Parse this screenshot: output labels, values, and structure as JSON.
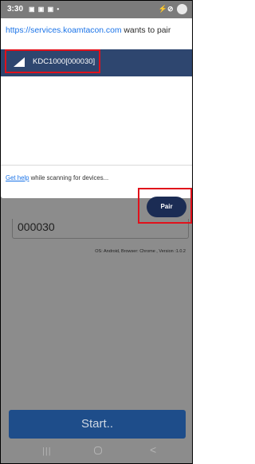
{
  "status_bar": {
    "time": "3:30",
    "left_icons": "▣ ▣ ▣ •",
    "right_icons": "⚡⊘"
  },
  "dialog": {
    "origin": "https://services.koamtacon.com",
    "message": " wants to pair",
    "devices": [
      {
        "name": "KDC1000[000030]",
        "selected": true
      }
    ],
    "help_link": "Get help",
    "scan_status": " while scanning for devices...",
    "pair_label": "Pair"
  },
  "background_page": {
    "input_value": "000030",
    "os_info": "OS: Android, Browser: Chrome , Version :1.0.2",
    "start_label": "Start.."
  },
  "nav_bar": {
    "recents": "|||",
    "back": "<"
  },
  "colors": {
    "selected_row": "#2e466f",
    "highlight": "#e1111b",
    "pair_button": "#1b2c54",
    "start_button": "#1e4d8a",
    "link": "#1a73e8"
  }
}
